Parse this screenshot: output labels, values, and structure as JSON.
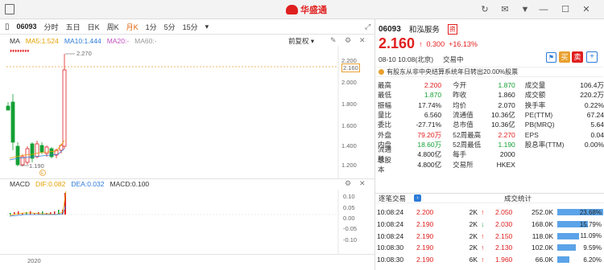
{
  "app": {
    "title": "华盛通"
  },
  "toolbar": {
    "code": "06093",
    "periods": [
      "分时",
      "五日",
      "日K",
      "周K",
      "月K",
      "1分",
      "5分",
      "15分"
    ],
    "selected_period": "月K"
  },
  "ma": {
    "label": "MA",
    "ma5": "MA5:1.524",
    "ma10": "MA10:1.444",
    "ma20": "MA20:-",
    "ma60": "MA60:-",
    "adjust": "前复权"
  },
  "price_axis": [
    "2.200",
    "2.160",
    "2.000",
    "1.800",
    "1.600",
    "1.400",
    "1.200"
  ],
  "annotations": {
    "high": "2.270",
    "low": "1.190"
  },
  "macd": {
    "label": "MACD",
    "dif": "DIF:0.082",
    "dea": "DEA:0.032",
    "macd": "MACD:0.100",
    "axis": [
      "0.10",
      "0.05",
      "0.00",
      "-0.05",
      "-0.10"
    ]
  },
  "x_axis": {
    "label": "2020"
  },
  "stock": {
    "code": "06093",
    "name": "和泓服务",
    "badge": "资",
    "price": "2.160",
    "change": "0.300",
    "change_pct": "+16.13%",
    "time": "08-10  10:08(北京)",
    "status": "交易中",
    "buy": "买",
    "sell": "卖",
    "notice": "有股东从非中央结算系统年日转出20.00%股票"
  },
  "quote": [
    [
      "最高",
      "2.200",
      "red",
      "今开",
      "1.870",
      "green",
      "成交量",
      "106.4万",
      "dark"
    ],
    [
      "最低",
      "1.870",
      "green",
      "昨收",
      "1.860",
      "dark",
      "成交额",
      "220.2万",
      "dark"
    ],
    [
      "振幅",
      "17.74%",
      "dark",
      "均价",
      "2.070",
      "dark",
      "换手率",
      "0.22%",
      "dark"
    ],
    [
      "量比",
      "6.560",
      "dark",
      "流通值",
      "10.36亿",
      "dark",
      "PE(TTM)",
      "67.24",
      "dark"
    ],
    [
      "委比",
      "-27.71%",
      "dark",
      "总市值",
      "10.36亿",
      "dark",
      "PB(MRQ)",
      "5.64",
      "dark"
    ],
    [
      "外盘",
      "79.20万",
      "red",
      "52周最高",
      "2.270",
      "red",
      "EPS",
      "0.04",
      "dark"
    ],
    [
      "内盘",
      "18.60万",
      "green",
      "52周最低",
      "1.190",
      "green",
      "股息率(TTM)",
      "0.00%",
      "dark"
    ],
    [
      "流通股",
      "4.800亿",
      "dark",
      "每手",
      "2000",
      "dark",
      "",
      "",
      ""
    ],
    [
      "总股本",
      "4.800亿",
      "dark",
      "交易所",
      "HKEX",
      "dark",
      "",
      "",
      ""
    ]
  ],
  "trades_header": {
    "left": "逐笔交易",
    "right": "成交统计"
  },
  "trades": [
    {
      "time": "10:08:24",
      "price": "2.200",
      "pcolor": "red",
      "vol": "2K",
      "dir": "up",
      "sprice": "2.050",
      "svol": "252.0K",
      "pct": "23.68%",
      "frac": 0.237
    },
    {
      "time": "10:08:24",
      "price": "2.190",
      "pcolor": "red",
      "vol": "2K",
      "dir": "down",
      "sprice": "2.030",
      "svol": "168.0K",
      "pct": "15.79%",
      "frac": 0.158
    },
    {
      "time": "10:08:24",
      "price": "2.190",
      "pcolor": "red",
      "vol": "2K",
      "dir": "up",
      "sprice": "2.150",
      "svol": "118.0K",
      "pct": "11.09%",
      "frac": 0.111
    },
    {
      "time": "10:08:30",
      "price": "2.190",
      "pcolor": "red",
      "vol": "2K",
      "dir": "up",
      "sprice": "2.130",
      "svol": "102.0K",
      "pct": "9.59%",
      "frac": 0.096
    },
    {
      "time": "10:08:30",
      "price": "2.190",
      "pcolor": "red",
      "vol": "6K",
      "dir": "up",
      "sprice": "1.960",
      "svol": "66.0K",
      "pct": "6.20%",
      "frac": 0.062
    }
  ]
}
